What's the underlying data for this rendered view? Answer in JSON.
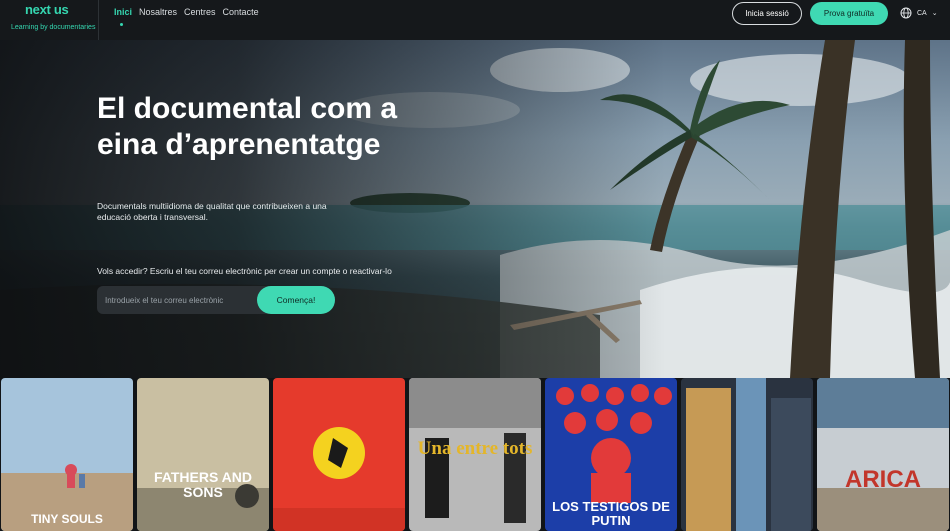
{
  "brand": {
    "name": "next us",
    "tagline": "Learning by documentaries"
  },
  "nav": {
    "items": [
      {
        "label": "Inici",
        "active": true
      },
      {
        "label": "Nosaltres",
        "active": false
      },
      {
        "label": "Centres",
        "active": false
      },
      {
        "label": "Contacte",
        "active": false
      }
    ],
    "login_label": "Inicia sessió",
    "trial_label": "Prova gratuïta",
    "language": "CA"
  },
  "hero": {
    "title": "El documental com a eina d’aprenentatge",
    "subtitle": "Documentals multiidioma de qualitat que contribueixen a una educació oberta i transversal.",
    "prompt": "Vols accedir? Escriu el teu correu electrònic per crear un compte o reactivar-lo",
    "email_placeholder": "Introdueix el teu correu electrònic",
    "start_label": "Comença!"
  },
  "posters": [
    {
      "title": "TINY SOULS"
    },
    {
      "title": "FATHERS AND SONS"
    },
    {
      "title": ""
    },
    {
      "title": "Una entre tots"
    },
    {
      "title": "LOS TESTIGOS DE PUTIN"
    },
    {
      "title": ""
    },
    {
      "title": "ARICA"
    }
  ],
  "colors": {
    "accent": "#3fd9b3",
    "nav_bg": "#15181b",
    "input_bg": "#2b3034"
  }
}
